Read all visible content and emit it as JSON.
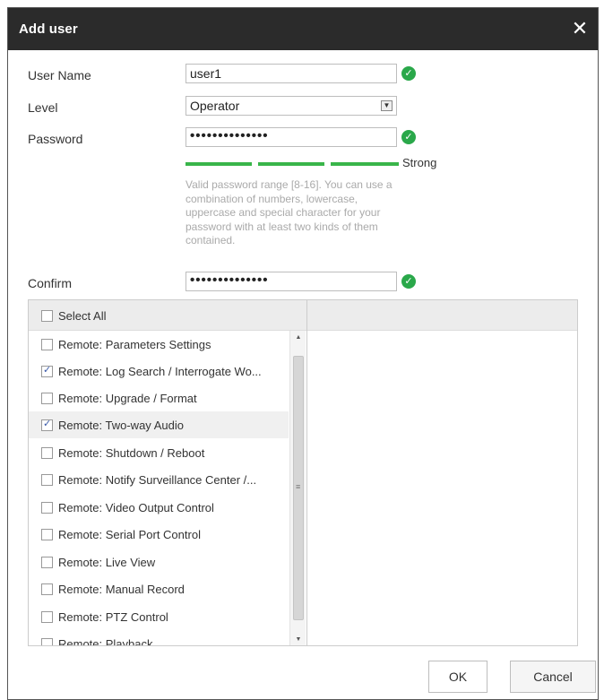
{
  "dialog": {
    "title": "Add user",
    "close_icon": "✕"
  },
  "form": {
    "username_label": "User Name",
    "username_value": "user1",
    "level_label": "Level",
    "level_value": "Operator",
    "password_label": "Password",
    "password_value": "••••••••••••••",
    "strength_label": "Strong",
    "password_hint": "Valid password range [8-16]. You can use a combination of numbers, lowercase, uppercase and special character for your password with at least two kinds of them contained.",
    "confirm_label": "Confirm",
    "confirm_value": "••••••••••••••",
    "valid_icon": "✓"
  },
  "permissions": {
    "select_all_label": "Select All",
    "items": [
      {
        "label": "Remote: Parameters Settings",
        "checked": false
      },
      {
        "label": "Remote: Log Search / Interrogate Wo...",
        "checked": true
      },
      {
        "label": "Remote: Upgrade / Format",
        "checked": false
      },
      {
        "label": "Remote: Two-way Audio",
        "checked": true
      },
      {
        "label": "Remote: Shutdown / Reboot",
        "checked": false
      },
      {
        "label": "Remote: Notify Surveillance Center /...",
        "checked": false
      },
      {
        "label": "Remote: Video Output Control",
        "checked": false
      },
      {
        "label": "Remote: Serial Port Control",
        "checked": false
      },
      {
        "label": "Remote: Live View",
        "checked": false
      },
      {
        "label": "Remote: Manual Record",
        "checked": false
      },
      {
        "label": "Remote: PTZ Control",
        "checked": false
      },
      {
        "label": "Remote: Playback",
        "checked": false
      }
    ]
  },
  "buttons": {
    "ok": "OK",
    "cancel": "Cancel"
  },
  "colors": {
    "valid_green": "#2aa84a",
    "strength_green": "#39b54a",
    "titlebar": "#2b2b2b"
  }
}
